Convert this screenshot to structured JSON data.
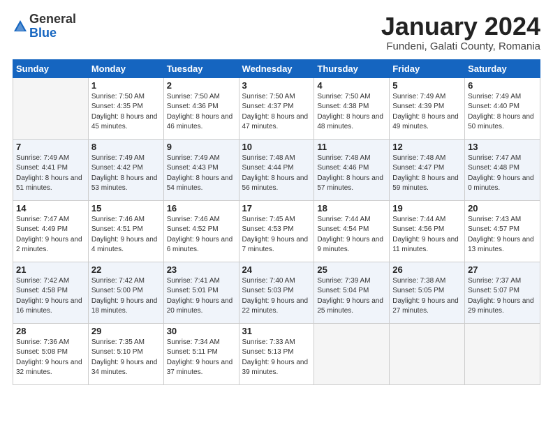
{
  "header": {
    "logo_general": "General",
    "logo_blue": "Blue",
    "cal_title": "January 2024",
    "cal_subtitle": "Fundeni, Galati County, Romania"
  },
  "weekdays": [
    "Sunday",
    "Monday",
    "Tuesday",
    "Wednesday",
    "Thursday",
    "Friday",
    "Saturday"
  ],
  "weeks": [
    [
      {
        "num": "",
        "detail": ""
      },
      {
        "num": "1",
        "detail": "Sunrise: 7:50 AM\nSunset: 4:35 PM\nDaylight: 8 hours\nand 45 minutes."
      },
      {
        "num": "2",
        "detail": "Sunrise: 7:50 AM\nSunset: 4:36 PM\nDaylight: 8 hours\nand 46 minutes."
      },
      {
        "num": "3",
        "detail": "Sunrise: 7:50 AM\nSunset: 4:37 PM\nDaylight: 8 hours\nand 47 minutes."
      },
      {
        "num": "4",
        "detail": "Sunrise: 7:50 AM\nSunset: 4:38 PM\nDaylight: 8 hours\nand 48 minutes."
      },
      {
        "num": "5",
        "detail": "Sunrise: 7:49 AM\nSunset: 4:39 PM\nDaylight: 8 hours\nand 49 minutes."
      },
      {
        "num": "6",
        "detail": "Sunrise: 7:49 AM\nSunset: 4:40 PM\nDaylight: 8 hours\nand 50 minutes."
      }
    ],
    [
      {
        "num": "7",
        "detail": "Sunrise: 7:49 AM\nSunset: 4:41 PM\nDaylight: 8 hours\nand 51 minutes."
      },
      {
        "num": "8",
        "detail": "Sunrise: 7:49 AM\nSunset: 4:42 PM\nDaylight: 8 hours\nand 53 minutes."
      },
      {
        "num": "9",
        "detail": "Sunrise: 7:49 AM\nSunset: 4:43 PM\nDaylight: 8 hours\nand 54 minutes."
      },
      {
        "num": "10",
        "detail": "Sunrise: 7:48 AM\nSunset: 4:44 PM\nDaylight: 8 hours\nand 56 minutes."
      },
      {
        "num": "11",
        "detail": "Sunrise: 7:48 AM\nSunset: 4:46 PM\nDaylight: 8 hours\nand 57 minutes."
      },
      {
        "num": "12",
        "detail": "Sunrise: 7:48 AM\nSunset: 4:47 PM\nDaylight: 8 hours\nand 59 minutes."
      },
      {
        "num": "13",
        "detail": "Sunrise: 7:47 AM\nSunset: 4:48 PM\nDaylight: 9 hours\nand 0 minutes."
      }
    ],
    [
      {
        "num": "14",
        "detail": "Sunrise: 7:47 AM\nSunset: 4:49 PM\nDaylight: 9 hours\nand 2 minutes."
      },
      {
        "num": "15",
        "detail": "Sunrise: 7:46 AM\nSunset: 4:51 PM\nDaylight: 9 hours\nand 4 minutes."
      },
      {
        "num": "16",
        "detail": "Sunrise: 7:46 AM\nSunset: 4:52 PM\nDaylight: 9 hours\nand 6 minutes."
      },
      {
        "num": "17",
        "detail": "Sunrise: 7:45 AM\nSunset: 4:53 PM\nDaylight: 9 hours\nand 7 minutes."
      },
      {
        "num": "18",
        "detail": "Sunrise: 7:44 AM\nSunset: 4:54 PM\nDaylight: 9 hours\nand 9 minutes."
      },
      {
        "num": "19",
        "detail": "Sunrise: 7:44 AM\nSunset: 4:56 PM\nDaylight: 9 hours\nand 11 minutes."
      },
      {
        "num": "20",
        "detail": "Sunrise: 7:43 AM\nSunset: 4:57 PM\nDaylight: 9 hours\nand 13 minutes."
      }
    ],
    [
      {
        "num": "21",
        "detail": "Sunrise: 7:42 AM\nSunset: 4:58 PM\nDaylight: 9 hours\nand 16 minutes."
      },
      {
        "num": "22",
        "detail": "Sunrise: 7:42 AM\nSunset: 5:00 PM\nDaylight: 9 hours\nand 18 minutes."
      },
      {
        "num": "23",
        "detail": "Sunrise: 7:41 AM\nSunset: 5:01 PM\nDaylight: 9 hours\nand 20 minutes."
      },
      {
        "num": "24",
        "detail": "Sunrise: 7:40 AM\nSunset: 5:03 PM\nDaylight: 9 hours\nand 22 minutes."
      },
      {
        "num": "25",
        "detail": "Sunrise: 7:39 AM\nSunset: 5:04 PM\nDaylight: 9 hours\nand 25 minutes."
      },
      {
        "num": "26",
        "detail": "Sunrise: 7:38 AM\nSunset: 5:05 PM\nDaylight: 9 hours\nand 27 minutes."
      },
      {
        "num": "27",
        "detail": "Sunrise: 7:37 AM\nSunset: 5:07 PM\nDaylight: 9 hours\nand 29 minutes."
      }
    ],
    [
      {
        "num": "28",
        "detail": "Sunrise: 7:36 AM\nSunset: 5:08 PM\nDaylight: 9 hours\nand 32 minutes."
      },
      {
        "num": "29",
        "detail": "Sunrise: 7:35 AM\nSunset: 5:10 PM\nDaylight: 9 hours\nand 34 minutes."
      },
      {
        "num": "30",
        "detail": "Sunrise: 7:34 AM\nSunset: 5:11 PM\nDaylight: 9 hours\nand 37 minutes."
      },
      {
        "num": "31",
        "detail": "Sunrise: 7:33 AM\nSunset: 5:13 PM\nDaylight: 9 hours\nand 39 minutes."
      },
      {
        "num": "",
        "detail": ""
      },
      {
        "num": "",
        "detail": ""
      },
      {
        "num": "",
        "detail": ""
      }
    ]
  ]
}
